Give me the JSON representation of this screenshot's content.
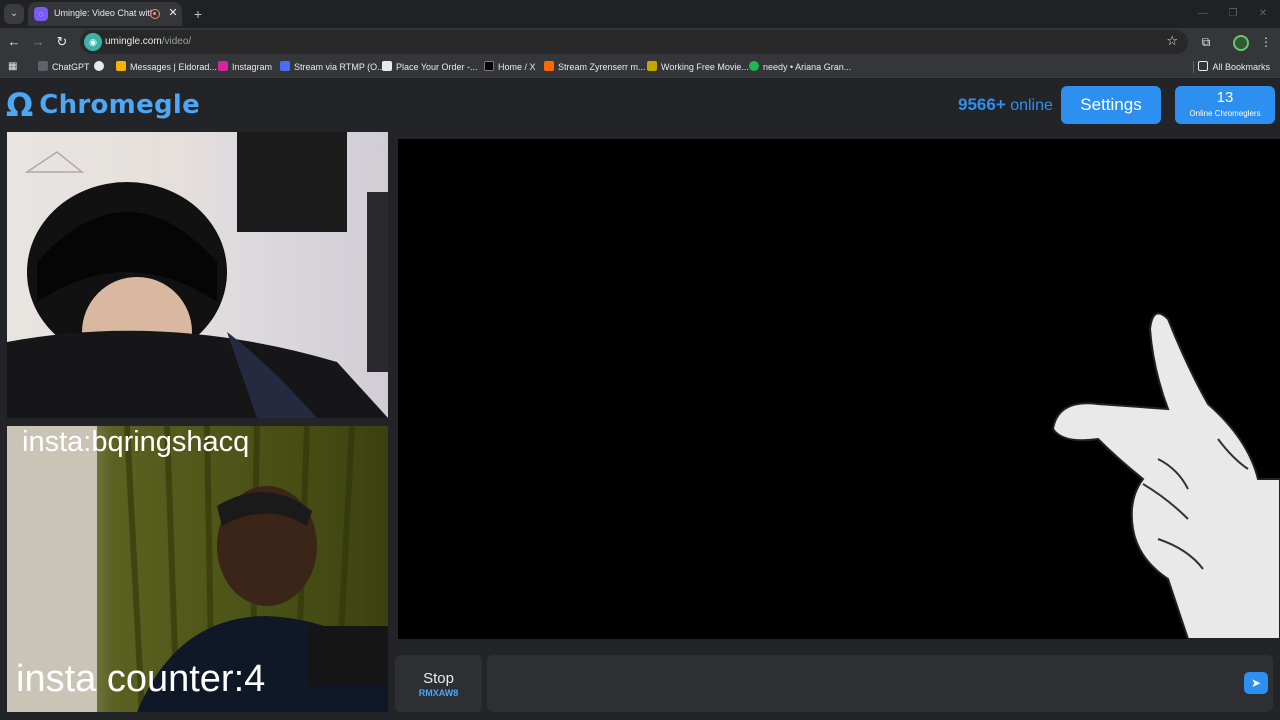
{
  "browser": {
    "tab_title": "Umingle: Video Chat with St",
    "tab_close": "✕",
    "new_tab": "+",
    "url_host": "umingle.com",
    "url_path": "/video/",
    "bookmarks": [
      {
        "label": "ChatGPT",
        "color": "#5f6368"
      },
      {
        "label": "",
        "color": "#e8eaed"
      },
      {
        "label": "Messages | Eldorad...",
        "color": "#f4b400"
      },
      {
        "label": "Instagram",
        "color": "#d6249f"
      },
      {
        "label": "Stream via RTMP (O...",
        "color": "#4a6cf7"
      },
      {
        "label": "Place Your Order -...",
        "color": "#e8eaed"
      },
      {
        "label": "Home / X",
        "color": "#000000"
      },
      {
        "label": "Stream Zyrenserr m...",
        "color": "#ff6a00"
      },
      {
        "label": "Working Free Movie...",
        "color": "#c6a700"
      },
      {
        "label": "needy • Ariana Gran...",
        "color": "#1db954"
      }
    ],
    "all_bookmarks": "All Bookmarks"
  },
  "header": {
    "logo_symbol": "Ω",
    "logo_text": "Chromegle",
    "online_count": "9566+",
    "online_label": "online",
    "settings_label": "Settings",
    "chromeglers_count": "13",
    "chromeglers_label": "Online Chromeglers"
  },
  "videos": {
    "stranger_overlay_top": "insta:bqringshacq",
    "stranger_overlay_bottom": "insta counter:4"
  },
  "controls": {
    "stop_label": "Stop",
    "stop_code": "RMXAW8",
    "chat_placeholder": "",
    "send_icon": "➤"
  },
  "colors": {
    "accent": "#2d8ff0",
    "logo": "#4ca8f5",
    "background": "#232427"
  }
}
